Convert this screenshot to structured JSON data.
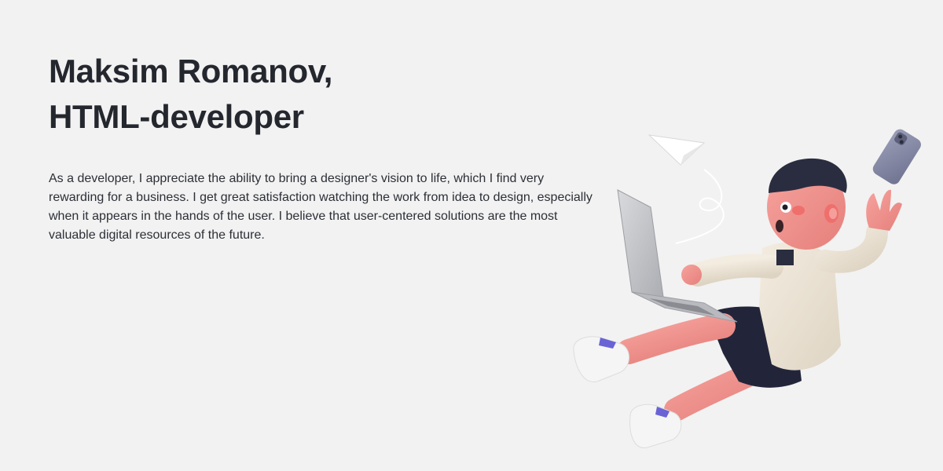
{
  "hero": {
    "title_line1": "Maksim Romanov,",
    "title_line2": "HTML-developer",
    "bio": "As a developer, I appreciate the ability to bring a designer's vision to life, which I find very rewarding for a business. I get great satisfaction watching the work from idea to design, especially when it appears in the hands of the user. I believe that user-centered solutions are the most valuable digital resources of the future."
  },
  "illustration": {
    "icon": "flying-developer-illustration",
    "colors": {
      "background": "#f2f2f2",
      "heading": "#24272e",
      "skin": "#f08c88",
      "hair": "#2a2d3f",
      "sweater": "#eee6d8",
      "shorts": "#22253a",
      "laptop": "#c8c9cc",
      "phone": "#8a8ea8",
      "shoe_accent": "#6a63d6"
    }
  }
}
